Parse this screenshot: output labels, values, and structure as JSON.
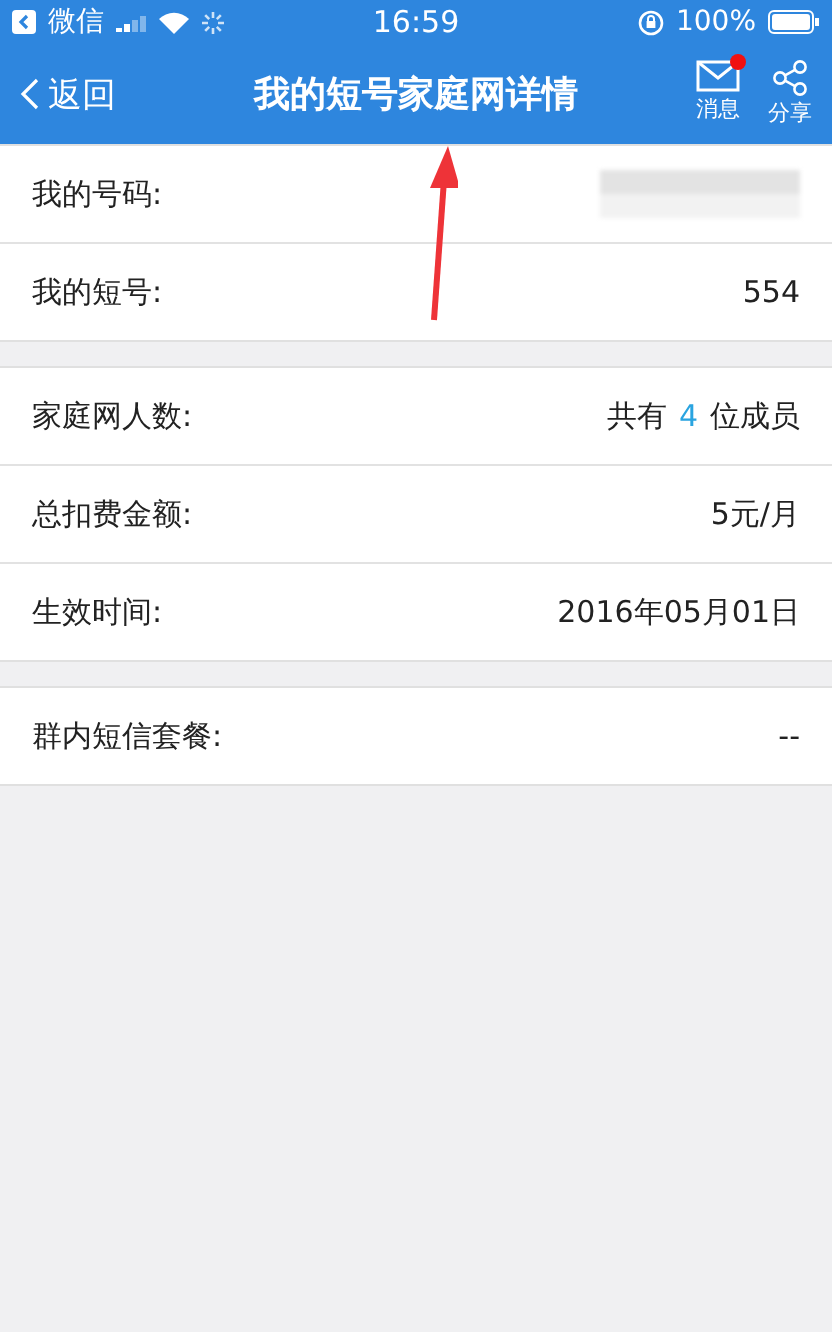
{
  "status_bar": {
    "back_app": "微信",
    "time": "16:59",
    "battery": "100%"
  },
  "nav": {
    "back": "返回",
    "title": "我的短号家庭网详情",
    "actions": [
      {
        "label": "消息",
        "kind": "mail",
        "badge": true
      },
      {
        "label": "分享",
        "kind": "share",
        "badge": false
      }
    ]
  },
  "sections": [
    [
      {
        "label": "我的号码:",
        "kind": "masked"
      },
      {
        "label": "我的短号:",
        "kind": "text",
        "value": "554"
      }
    ],
    [
      {
        "label": "家庭网人数:",
        "kind": "count",
        "prefix": "共有",
        "count": "4",
        "suffix": "位成员"
      },
      {
        "label": "总扣费金额:",
        "kind": "text",
        "value": "5元/月"
      },
      {
        "label": "生效时间:",
        "kind": "text",
        "value": "2016年05月01日"
      }
    ],
    [
      {
        "label": "群内短信套餐:",
        "kind": "text",
        "value": "--"
      }
    ]
  ],
  "annotation": {
    "kind": "arrow",
    "color": "#ee3338"
  }
}
